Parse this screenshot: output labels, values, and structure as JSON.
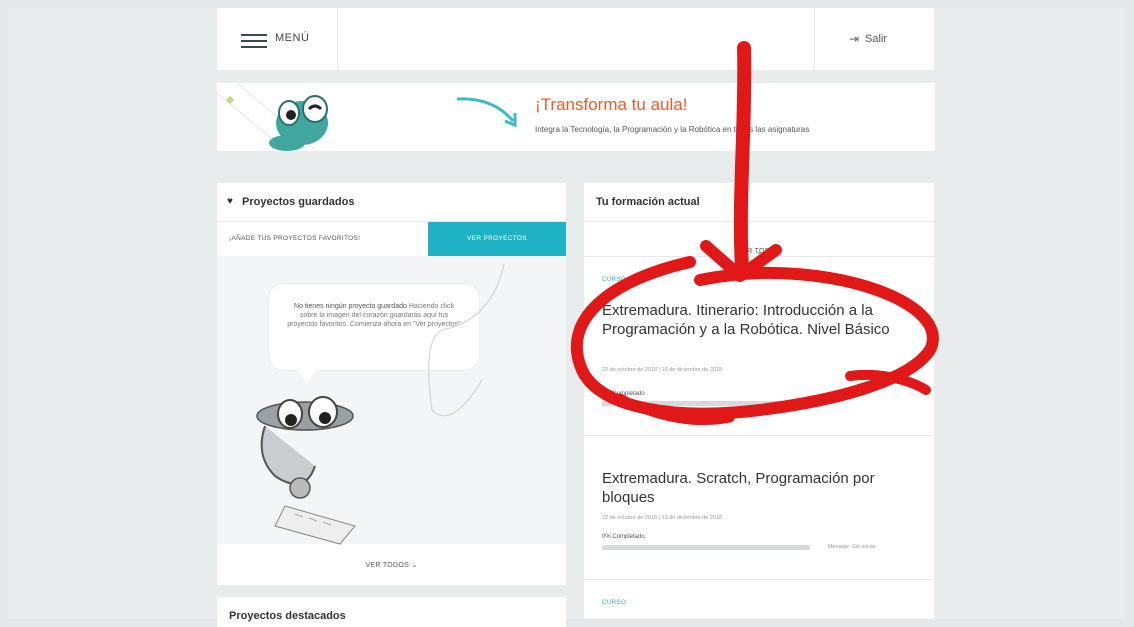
{
  "header": {
    "menu_label": "MENÚ",
    "exit_label": "Salir"
  },
  "banner": {
    "title": "¡Transforma tu aula!",
    "subtitle": "Integra la Tecnología, la Programación y la Robótica en todas las asignaturas"
  },
  "saved_projects": {
    "title": "Proyectos guardados",
    "tab_favorites": "¡AÑADE TUS PROYECTOS FAVORITOS!",
    "tab_see_projects": "VER PROYECTOS",
    "empty_title": "No tienes ningún proyecto guardado",
    "empty_text": "Haciendo click sobre la imagen del corazón guardarás aquí tus proyectos favoritos. Comienza ahora en \"Ver proyectos\"",
    "see_all": "VER TODOS"
  },
  "featured_projects": {
    "title": "Proyectos destacados"
  },
  "training": {
    "title": "Tu formación actual",
    "see_all": "VER TODOS",
    "courses": [
      {
        "type": "CURSO",
        "title": "Extremadura. Itinerario: Introducción a la Programación y a la Robótica. Nivel Básico",
        "dates": "22 de octubre de 2018 | 19 de diciembre de 2018",
        "progress_label": "0% Completado",
        "progress": 0,
        "note": ""
      },
      {
        "type": "",
        "title": "Extremadura. Scratch, Programación por bloques",
        "dates": "22 de octubre de 2018 | 19 de diciembre de 2018",
        "progress_label": "0% Completado",
        "progress": 0,
        "note": "Mensaje: Sin iniciar"
      },
      {
        "type": "CURSO",
        "title": "",
        "dates": "",
        "progress_label": "",
        "progress": 0,
        "note": ""
      }
    ]
  },
  "colors": {
    "accent": "#1fb2c4",
    "banner_title": "#e85d2a",
    "background": "#e4e8ea",
    "scribble": "#e01818"
  },
  "icons": {
    "menu": "hamburger-icon",
    "exit": "exit-icon",
    "heart": "heart-icon",
    "chevron": "chevron-down-icon"
  }
}
